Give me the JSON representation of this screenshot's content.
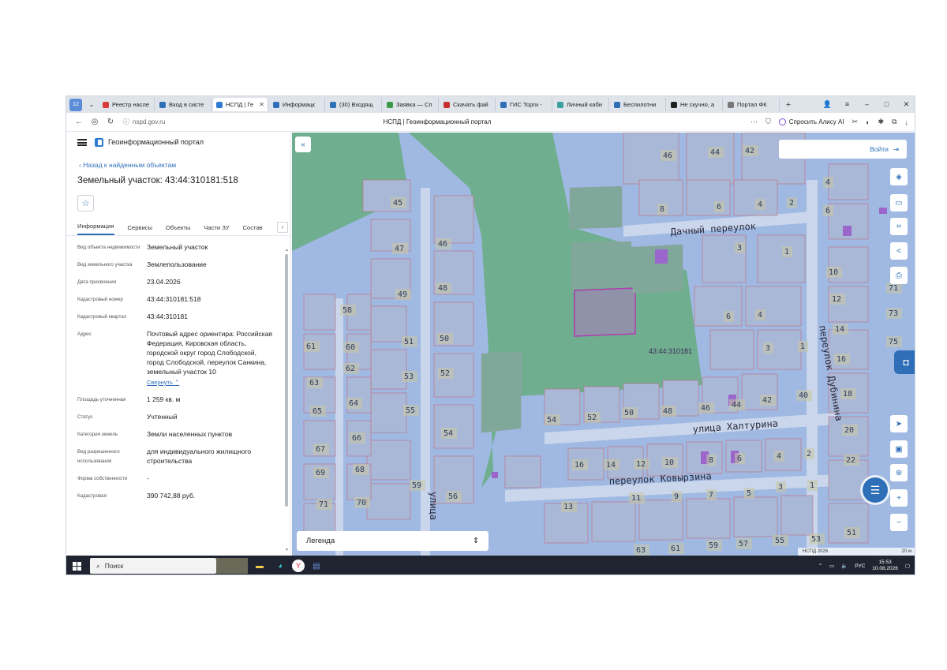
{
  "browser": {
    "tabs": [
      {
        "title": "Реестр насле",
        "color": "#d93b3b"
      },
      {
        "title": "Вход в систе",
        "color": "#2f6fb8"
      },
      {
        "title": "НСПД | Ге",
        "color": "#2f7bd1",
        "active": true
      },
      {
        "title": "Информацк",
        "color": "#2f6fb8"
      },
      {
        "title": "(30) Входящ",
        "color": "#2f6fb8"
      },
      {
        "title": "Заявка — Сп",
        "color": "#3a9a4a"
      },
      {
        "title": "Скачать фай",
        "color": "#c7302f"
      },
      {
        "title": "ГИС Торги -",
        "color": "#2f6fb8"
      },
      {
        "title": "Личный каби",
        "color": "#3aa0a0"
      },
      {
        "title": "Беспилотни",
        "color": "#2f6fb8"
      },
      {
        "title": "Не скучно, а",
        "color": "#222222"
      },
      {
        "title": "Портал ФК",
        "color": "#777777"
      }
    ],
    "tab_counter": "12",
    "url": "nspd.gov.ru",
    "page_title": "НСПД | Геоинформационный портал",
    "alice_label": "Спросить Алису AI"
  },
  "panel": {
    "portal_name": "Геоинформационный портал",
    "back_link": "Назад к найденным объектам",
    "object_title": "Земельный участок: 43:44:310181:518",
    "tabs": [
      "Информация",
      "Сервисы",
      "Объекты",
      "Части ЗУ",
      "Состав"
    ],
    "properties": [
      {
        "key": "Вид объекта недвижимости",
        "value": "Земельный участок"
      },
      {
        "key": "Вид земельного участка",
        "value": "Землепользование"
      },
      {
        "key": "Дата присвоения",
        "value": "23.04.2026"
      },
      {
        "key": "Кадастровый номер",
        "value": "43:44:310181:518"
      },
      {
        "key": "Кадастровый квартал",
        "value": "43:44:310181"
      },
      {
        "key": "Адрес",
        "value": "Почтовый адрес ориентира: Российская Федерация, Кировская область, городской округ город Слободской, город Слободской, переулок Санкина, земельный участок 10"
      },
      {
        "key": "Площадь уточненная",
        "value": "1 259 кв. м"
      },
      {
        "key": "Статус",
        "value": "Учтенный"
      },
      {
        "key": "Категория земель",
        "value": "Земли населенных пунктов"
      },
      {
        "key": "Вид разрешенного использования",
        "value": "для индивидуального жилищного строительства"
      },
      {
        "key": "Форма собственности",
        "value": "-"
      },
      {
        "key": "Кадастровая",
        "value": "390 742,88 руб."
      }
    ],
    "collapse_label": "Свернуть"
  },
  "map": {
    "login_label": "Войти",
    "legend_label": "Легенда",
    "attribution": "НСПД 2026",
    "scale": "20 м",
    "quarter_label": "43:44:310181",
    "streets": [
      "Дачный переулок",
      "улица Халтурина",
      "переулок Ковырзина",
      "переулок Дубинина",
      "улица"
    ],
    "colors": {
      "base": "#9fb9e2",
      "green": "#6fae8f",
      "road": "#c9d6ec",
      "parcel": "#aab8d8",
      "label_bg": "#c9c9a3"
    }
  },
  "taskbar": {
    "search_label": "Поиск",
    "lang": "РУС",
    "time": "15:53",
    "date": "10.08.2026"
  }
}
